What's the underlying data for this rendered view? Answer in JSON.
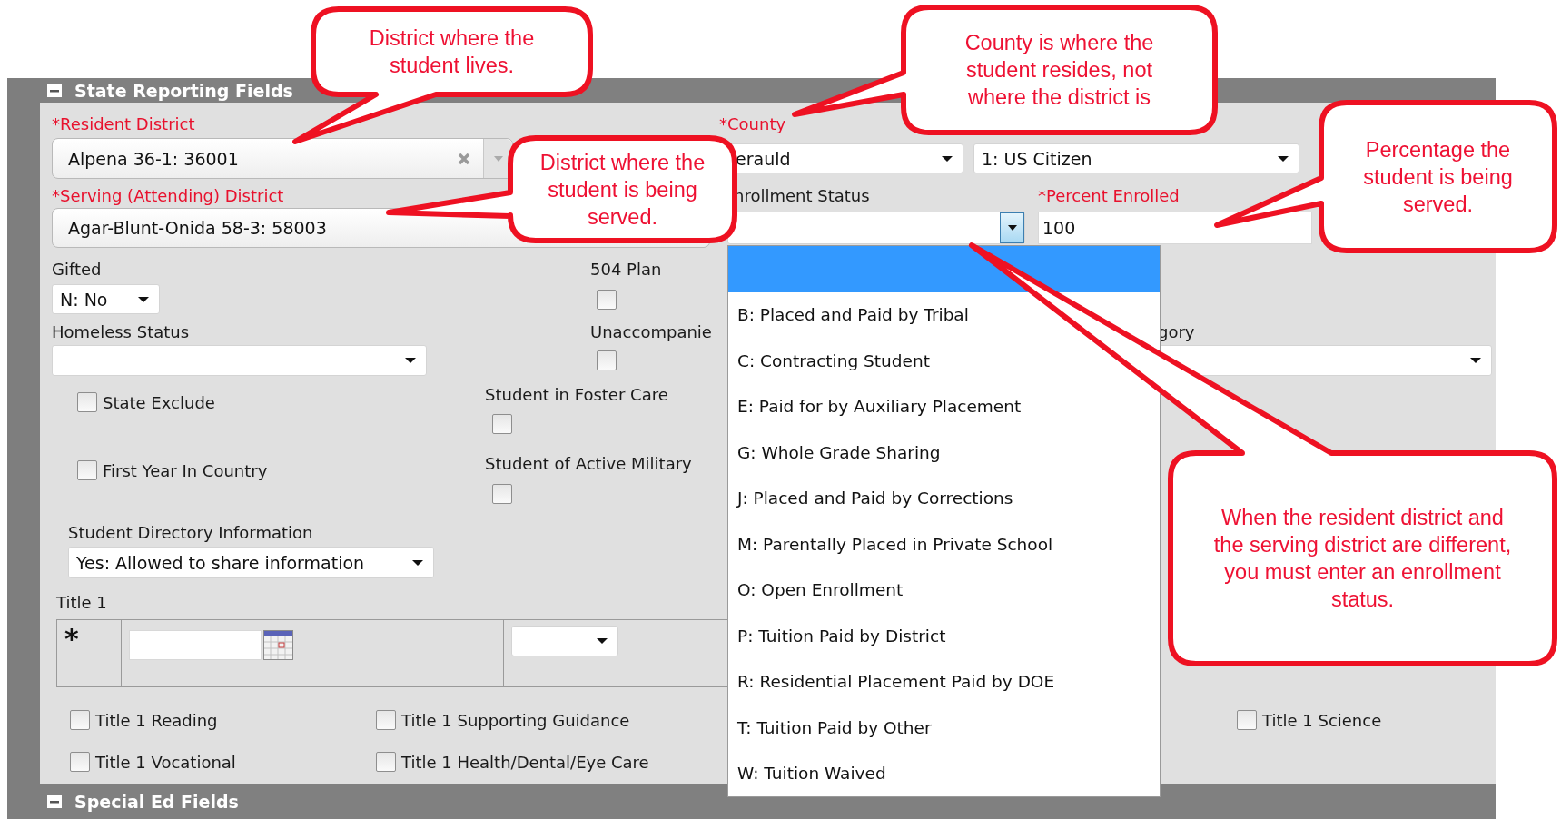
{
  "section": {
    "title": "State Reporting Fields",
    "expanded": true
  },
  "resident_district": {
    "label": "*Resident District",
    "required": true,
    "value": "Alpena 36-1: 36001"
  },
  "county": {
    "label": "*County",
    "required": true,
    "value": "erauld"
  },
  "citizenship": {
    "value": "1: US Citizen"
  },
  "serving_district": {
    "label": "*Serving (Attending) District",
    "required": true,
    "value": "Agar-Blunt-Onida 58-3: 58003"
  },
  "enrollment_status": {
    "label": "nrollment Status",
    "required": false,
    "open": true,
    "blank_option": {
      "selected": true
    },
    "options": [
      {
        "label": "B: Placed and Paid by Tribal",
        "selected": false
      },
      {
        "label": "C: Contracting Student",
        "selected": false
      },
      {
        "label": "E: Paid for by Auxiliary Placement",
        "selected": false
      },
      {
        "label": "G: Whole Grade Sharing",
        "selected": false
      },
      {
        "label": "J: Placed and Paid by Corrections",
        "selected": false
      },
      {
        "label": "M: Parentally Placed in Private School",
        "selected": false
      },
      {
        "label": "O: Open Enrollment",
        "selected": false
      },
      {
        "label": "P: Tuition Paid by District",
        "selected": false
      },
      {
        "label": "R: Residential Placement Paid by DOE",
        "selected": false
      },
      {
        "label": "T: Tuition Paid by Other",
        "selected": false
      },
      {
        "label": "W: Tuition Waived",
        "selected": false
      }
    ]
  },
  "percent_enrolled": {
    "label": "*Percent Enrolled",
    "required": true,
    "value": "100"
  },
  "gifted": {
    "label": "Gifted",
    "value": "N: No"
  },
  "plan_504": {
    "label": "504 Plan",
    "checked": false
  },
  "homeless_status": {
    "label": "Homeless Status"
  },
  "unaccompanied": {
    "label": "Unaccompanie",
    "checked": false
  },
  "category": {
    "label": "gory"
  },
  "state_exclude": {
    "label": "State Exclude",
    "checked": false
  },
  "first_year": {
    "label": "First Year In Country",
    "checked": false
  },
  "foster_care": {
    "label": "Student in Foster Care",
    "checked": false
  },
  "active_military": {
    "label": "Student of Active Military",
    "checked": false
  },
  "directory_info": {
    "label": "Student Directory Information",
    "value": "Yes: Allowed to share information"
  },
  "title_1": {
    "label": "Title 1",
    "marker": "*",
    "services": [
      {
        "label": "Title 1 Reading",
        "checked": false
      },
      {
        "label": "Title 1 Supporting Guidance",
        "checked": false
      },
      {
        "label": "Title 1 Science",
        "checked": false
      },
      {
        "label": "Title 1 Vocational",
        "checked": false
      },
      {
        "label": "Title 1 Health/Dental/Eye Care",
        "checked": false
      }
    ]
  },
  "next_section": {
    "title": "Special Ed Fields",
    "expanded": true
  },
  "callouts": [
    {
      "text": "District where the student lives."
    },
    {
      "text": "County is where the student resides, not where the district is"
    },
    {
      "text": "District where the student is being served."
    },
    {
      "text": "Percentage the student is being served."
    },
    {
      "text": "When the resident district and the serving district are different, you must enter an enrollment status."
    }
  ]
}
